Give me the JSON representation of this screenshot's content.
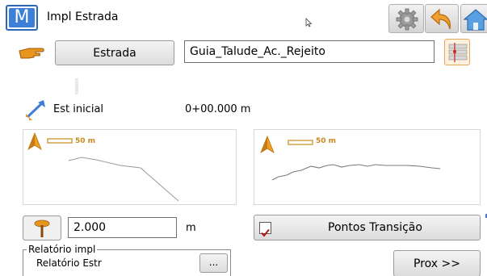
{
  "header": {
    "logo_letter": "M",
    "title": "Impl Estrada",
    "icons": [
      "gear-icon",
      "back-arrow-icon",
      "home-icon"
    ]
  },
  "road": {
    "button_label": "Estrada",
    "value": "Guia_Talude_Ac._Rejeito"
  },
  "start_station": {
    "label": "Est inicial",
    "value": "0+00.000 m"
  },
  "plan_view": {
    "north_label": "N",
    "scale_label": "50 m"
  },
  "profile_view": {
    "north_label": "H",
    "scale_label": "50 m"
  },
  "height": {
    "value": "2.000",
    "unit": "m"
  },
  "transition": {
    "label": "Pontos Transição",
    "checked": true
  },
  "report": {
    "legend": "Relatório impl",
    "value": "Relatório Estr",
    "browse_label": "..."
  },
  "footer": {
    "next_label": "Prox >>"
  },
  "colors": {
    "accent_blue": "#3b7fd6",
    "accent_orange": "#e8a85a",
    "scale_gold": "#c8891c"
  }
}
